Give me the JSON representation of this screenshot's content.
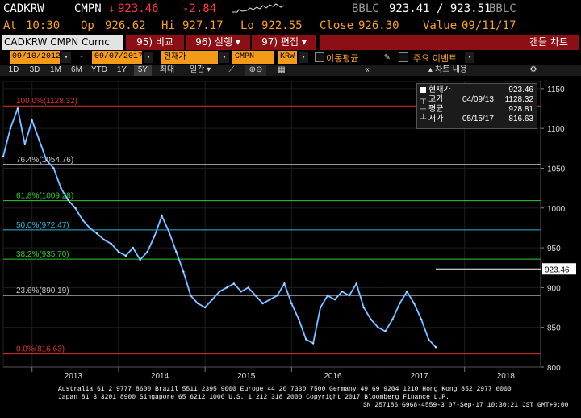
{
  "header": {
    "ticker": "CADKRW",
    "field": "CMPN",
    "arrow": "↓",
    "last": "923.46",
    "change": "-2.84",
    "src1": "BBLC",
    "bid_ask": "923.41 / 923.51",
    "src2": "BBLC",
    "at_label": "At",
    "at_value": "10:30",
    "op_label": "Op",
    "op_value": "926.62",
    "hi_label": "Hi",
    "hi_value": "927.17",
    "lo_label": "Lo",
    "lo_value": "922.55",
    "close_label": "Close",
    "close_value": "926.30",
    "value_label": "Value",
    "value_value": "09/11/17"
  },
  "cmdbar": {
    "security": "CADKRW CMPN Curnc",
    "btn_compare": "95) 비교",
    "btn_run": "96) 실행 ▾",
    "btn_edit": "97) 편집 ▾",
    "title": "캔들 차트"
  },
  "options": {
    "start_date": "09/10/2012",
    "end_date": "09/07/2017",
    "price_type": "현재가",
    "source": "CMPN",
    "currency": "KRW",
    "moving_avg": "이동평균",
    "events": "주요 이벤트"
  },
  "toolbar": {
    "ranges": [
      "1D",
      "3D",
      "1M",
      "6M",
      "YTD",
      "1Y",
      "5Y",
      "최대"
    ],
    "selected_range": "5Y",
    "period": "일간 ▾",
    "chart_contents": "차트 내용"
  },
  "legend": {
    "rows": [
      {
        "name": "현재가",
        "date": "",
        "value": "923.46"
      },
      {
        "name": "고가",
        "date": "04/09/13",
        "value": "1128.32"
      },
      {
        "name": "평균",
        "date": "",
        "value": "928.81"
      },
      {
        "name": "저가",
        "date": "05/15/17",
        "value": "816.63"
      }
    ]
  },
  "chart_data": {
    "type": "line",
    "title": "",
    "xlabel": "",
    "ylabel": "",
    "ylim": [
      800,
      1160
    ],
    "y_ticks": [
      800,
      850,
      900,
      950,
      1000,
      1050,
      1100,
      1150
    ],
    "x_ticks": [
      "2013",
      "2014",
      "2015",
      "2016",
      "2017",
      "2018"
    ],
    "x": [
      "2012-09",
      "2012-10",
      "2012-11",
      "2012-12",
      "2013-01",
      "2013-02",
      "2013-03",
      "2013-04",
      "2013-05",
      "2013-06",
      "2013-07",
      "2013-08",
      "2013-09",
      "2013-10",
      "2013-11",
      "2013-12",
      "2014-01",
      "2014-02",
      "2014-03",
      "2014-04",
      "2014-05",
      "2014-06",
      "2014-07",
      "2014-08",
      "2014-09",
      "2014-10",
      "2014-11",
      "2014-12",
      "2015-01",
      "2015-02",
      "2015-03",
      "2015-04",
      "2015-05",
      "2015-06",
      "2015-07",
      "2015-08",
      "2015-09",
      "2015-10",
      "2015-11",
      "2015-12",
      "2016-01",
      "2016-02",
      "2016-03",
      "2016-04",
      "2016-05",
      "2016-06",
      "2016-07",
      "2016-08",
      "2016-09",
      "2016-10",
      "2016-11",
      "2016-12",
      "2017-01",
      "2017-02",
      "2017-03",
      "2017-04",
      "2017-05",
      "2017-06",
      "2017-07",
      "2017-08",
      "2017-09"
    ],
    "series": [
      {
        "values": [
          1065,
          1100,
          1125,
          1080,
          1110,
          1085,
          1060,
          1050,
          1025,
          1010,
          1000,
          985,
          975,
          968,
          960,
          955,
          945,
          940,
          950,
          935,
          945,
          965,
          990,
          970,
          945,
          920,
          890,
          880,
          875,
          885,
          895,
          900,
          905,
          895,
          900,
          890,
          880,
          885,
          890,
          905,
          880,
          860,
          835,
          830,
          875,
          890,
          885,
          895,
          890,
          905,
          875,
          860,
          850,
          845,
          860,
          880,
          895,
          880,
          860,
          835,
          825
        ]
      }
    ],
    "fibonacci": [
      {
        "label": "100.0%(1128.32)",
        "value": 1128.32,
        "color": "#e03030"
      },
      {
        "label": "76.4%(1054.76)",
        "value": 1054.76,
        "color": "#c8c8c8"
      },
      {
        "label": "61.8%(1009.28)",
        "value": 1009.28,
        "color": "#2ecc2e"
      },
      {
        "label": "50.0%(972.47)",
        "value": 972.47,
        "color": "#2ab8d8"
      },
      {
        "label": "38.2%(935.70)",
        "value": 935.7,
        "color": "#2ecc2e"
      },
      {
        "label": "23.6%(890.19)",
        "value": 890.19,
        "color": "#c8c8c8"
      },
      {
        "label": "0.0%(816.63)",
        "value": 816.63,
        "color": "#e03030"
      }
    ],
    "last_price_label": "923.46",
    "last_price": 923.46
  },
  "footer": {
    "line1": "Australia 61 2 9777 8600 Brazil 5511 2395 9000 Europe 44 20 7330 7500 Germany 49 69 9204 1210 Hong Kong 852 2977 6000",
    "line2": "Japan 81 3 3201 8900        Singapore 65 6212 1000          U.S. 1 212 318 2000             Copyright 2017 Bloomberg Finance L.P.",
    "line3": "SN 257186 G968-4559-3 07-Sep-17 10:30:21 JST  GMT+9:00"
  },
  "colors": {
    "accent": "#f8a21c",
    "down": "#ff3b3b",
    "button_red": "#8c0f16",
    "series": "#4aa3ff"
  }
}
